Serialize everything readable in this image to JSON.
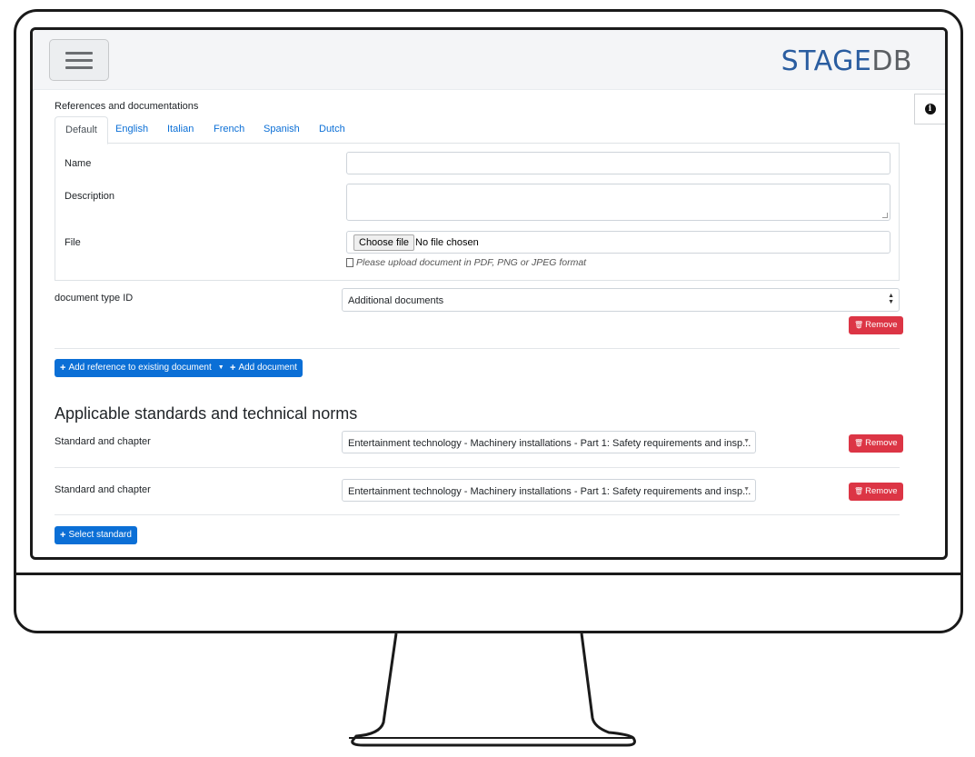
{
  "header": {
    "brand_stage": "STAGE",
    "brand_db": "DB",
    "menu_icon": "hamburger-icon",
    "info_icon": "info-circle-icon"
  },
  "references": {
    "section_label": "References and documentations",
    "tabs": [
      {
        "label": "Default",
        "active": true
      },
      {
        "label": "English",
        "active": false
      },
      {
        "label": "Italian",
        "active": false
      },
      {
        "label": "French",
        "active": false
      },
      {
        "label": "Spanish",
        "active": false
      },
      {
        "label": "Dutch",
        "active": false
      }
    ],
    "name_label": "Name",
    "name_value": "",
    "description_label": "Description",
    "description_value": "",
    "file_label": "File",
    "choose_file_label": "Choose file",
    "no_file_text": "No file chosen",
    "file_help": "Please upload document in PDF, PNG or JPEG format",
    "doc_type_label": "document type ID",
    "doc_type_value": "Additional documents",
    "remove_label": "Remove",
    "add_reference_label": "Add reference to existing document",
    "add_document_label": "Add document"
  },
  "standards": {
    "heading": "Applicable standards and technical norms",
    "rows": [
      {
        "label": "Standard and chapter",
        "value": "Entertainment technology - Machinery installations - Part 1: Safety requirements and insp...",
        "remove_label": "Remove"
      },
      {
        "label": "Standard and chapter",
        "value": "Entertainment technology - Machinery installations - Part 1: Safety requirements and insp...",
        "remove_label": "Remove"
      }
    ],
    "select_standard_label": "Select standard"
  },
  "colors": {
    "primary": "#0b6fd6",
    "danger": "#dc3545",
    "brand_blue": "#2a5da0",
    "brand_gray": "#5b5f63"
  }
}
